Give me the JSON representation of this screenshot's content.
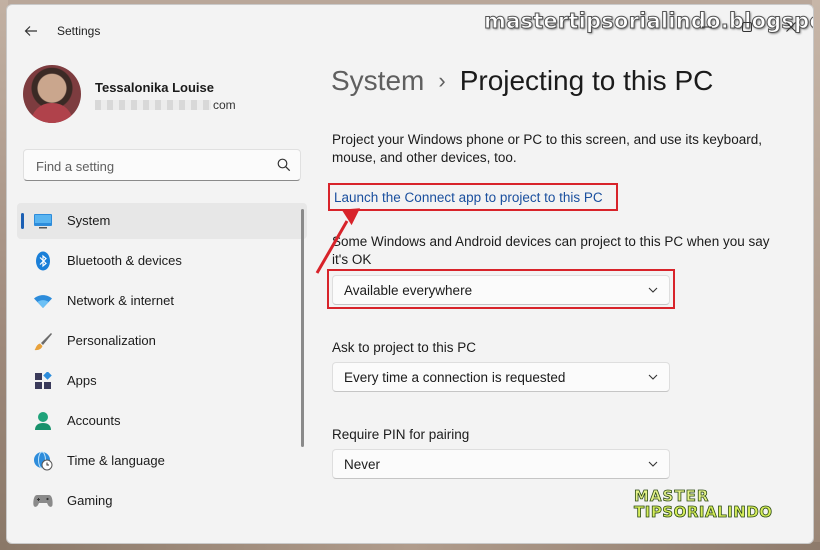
{
  "app": {
    "title": "Settings"
  },
  "watermark": {
    "top_text": "mastertipsorialindo.blogspot.com",
    "logo_line1": "MASTER",
    "logo_line2": "TIPSORIALINDO"
  },
  "profile": {
    "name": "Tessalonika Louise",
    "email_suffix": "com"
  },
  "search": {
    "placeholder": "Find a setting"
  },
  "sidebar": {
    "items": [
      {
        "label": "System",
        "icon": "monitor-icon",
        "active": true
      },
      {
        "label": "Bluetooth & devices",
        "icon": "bluetooth-icon"
      },
      {
        "label": "Network & internet",
        "icon": "wifi-icon"
      },
      {
        "label": "Personalization",
        "icon": "brush-icon"
      },
      {
        "label": "Apps",
        "icon": "apps-icon"
      },
      {
        "label": "Accounts",
        "icon": "person-icon"
      },
      {
        "label": "Time & language",
        "icon": "globe-clock-icon"
      },
      {
        "label": "Gaming",
        "icon": "gamepad-icon"
      }
    ]
  },
  "header": {
    "parent": "System",
    "separator": "›",
    "current": "Projecting to this PC"
  },
  "main": {
    "description": "Project your Windows phone or PC to this screen, and use its keyboard, mouse, and other devices, too.",
    "connect_link": "Launch the Connect app to project to this PC",
    "availability_label": "Some Windows and Android devices can project to this PC when you say it's OK",
    "availability_value": "Available everywhere",
    "ask_label": "Ask to project to this PC",
    "ask_value": "Every time a connection is requested",
    "pin_label": "Require PIN for pairing",
    "pin_value": "Never"
  },
  "colors": {
    "accent": "#1b5fb3",
    "highlight": "#d8232a",
    "link": "#1a4f9e"
  }
}
